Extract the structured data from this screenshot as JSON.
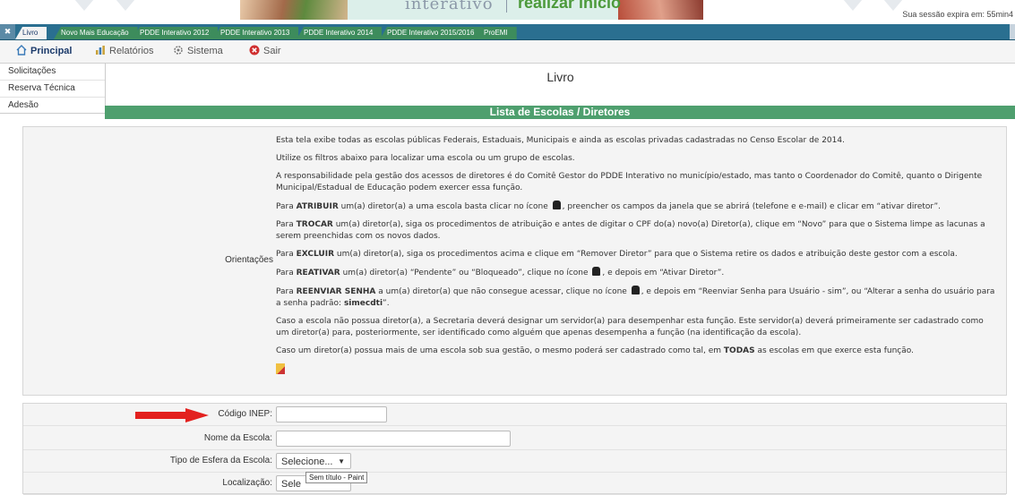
{
  "banner": {
    "logo_left": "interativo",
    "logo_right": "realizar inicio",
    "session": "Sua sessão expira em: 55min4"
  },
  "tabs": [
    "Livro",
    "Novo Mais Educação",
    "PDDE Interativo 2012",
    "PDDE Interativo 2013",
    "PDDE Interativo 2014",
    "PDDE Interativo 2015/2016",
    "ProEMI"
  ],
  "menu": {
    "principal": "Principal",
    "relatorios": "Relatórios",
    "sistema": "Sistema",
    "sair": "Sair"
  },
  "sidebar": {
    "items": [
      "Solicitações",
      "Reserva Técnica",
      "Adesão"
    ]
  },
  "page_title": "Livro",
  "section_title": "Lista de Escolas / Diretores",
  "orientations": {
    "label": "Orientações",
    "p1": "Esta tela exibe todas as escolas públicas Federais, Estaduais, Municipais e ainda as escolas privadas cadastradas no Censo Escolar de 2014.",
    "p2": "Utilize os filtros abaixo para localizar uma escola ou um grupo de escolas.",
    "p3": "A responsabilidade pela gestão dos acessos de diretores é do Comitê Gestor do PDDE Interativo no município/estado, mas tanto o Coordenador do Comitê, quanto o Dirigente Municipal/Estadual de Educação podem exercer essa função.",
    "p4_pre": "Para ",
    "p4_bold": "ATRIBUIR",
    "p4_mid": " um(a) diretor(a) a uma escola basta clicar no ícone ",
    "p4_post": ", preencher os campos da janela que se abrirá (telefone e e-mail) e clicar em “ativar diretor”.",
    "p5_pre": "Para ",
    "p5_bold": "TROCAR",
    "p5_post": " um(a) diretor(a), siga os procedimentos de atribuição e antes de digitar o CPF do(a) novo(a) Diretor(a), clique em “Novo” para que o Sistema limpe as lacunas a serem preenchidas com os novos dados.",
    "p6_pre": "Para ",
    "p6_bold": "EXCLUIR",
    "p6_post": " um(a) diretor(a), siga os procedimentos acima e clique em “Remover Diretor” para que o Sistema retire os dados e atribuição deste gestor com a escola.",
    "p7_pre": "Para ",
    "p7_bold": "REATIVAR",
    "p7_mid": " um(a) diretor(a) “Pendente” ou “Bloqueado”, clique no ícone ",
    "p7_post": ", e depois em “Ativar Diretor”.",
    "p8_pre": "Para ",
    "p8_bold": "REENVIAR SENHA",
    "p8_mid": " a um(a) diretor(a) que não consegue acessar, clique no ícone ",
    "p8_post": ", e depois em “Reenviar Senha para Usuário - sim”, ou  “Alterar a senha do usuário para a senha padrão: ",
    "p8_pw": "simecdti",
    "p8_end": "”.",
    "p9": "Caso a escola não possua diretor(a), a Secretaria deverá designar um servidor(a) para desempenhar esta função. Este servidor(a) deverá primeiramente ser cadastrado como um diretor(a) para, posteriormente, ser identificado como alguém que apenas desempenha a função (na identificação da escola).",
    "p10_pre": "Caso um diretor(a) possua mais de uma escola sob sua gestão, o mesmo poderá ser cadastrado como tal, em ",
    "p10_bold": "TODAS",
    "p10_post": " as escolas em que exerce esta função."
  },
  "form": {
    "codigo_label": "Código INEP:",
    "nome_label": "Nome da Escola:",
    "esfera_label": "Tipo de Esfera da Escola:",
    "esfera_value": "Selecione...",
    "localizacao_label": "Localização:",
    "localizacao_value": "Sele"
  },
  "tooltip": "Sem título - Paint",
  "colors": {
    "tab_bar": "#2a6f90",
    "tab_green": "#3d8c5c",
    "section_green": "#4e9f6e",
    "arrow_red": "#e3211f"
  }
}
